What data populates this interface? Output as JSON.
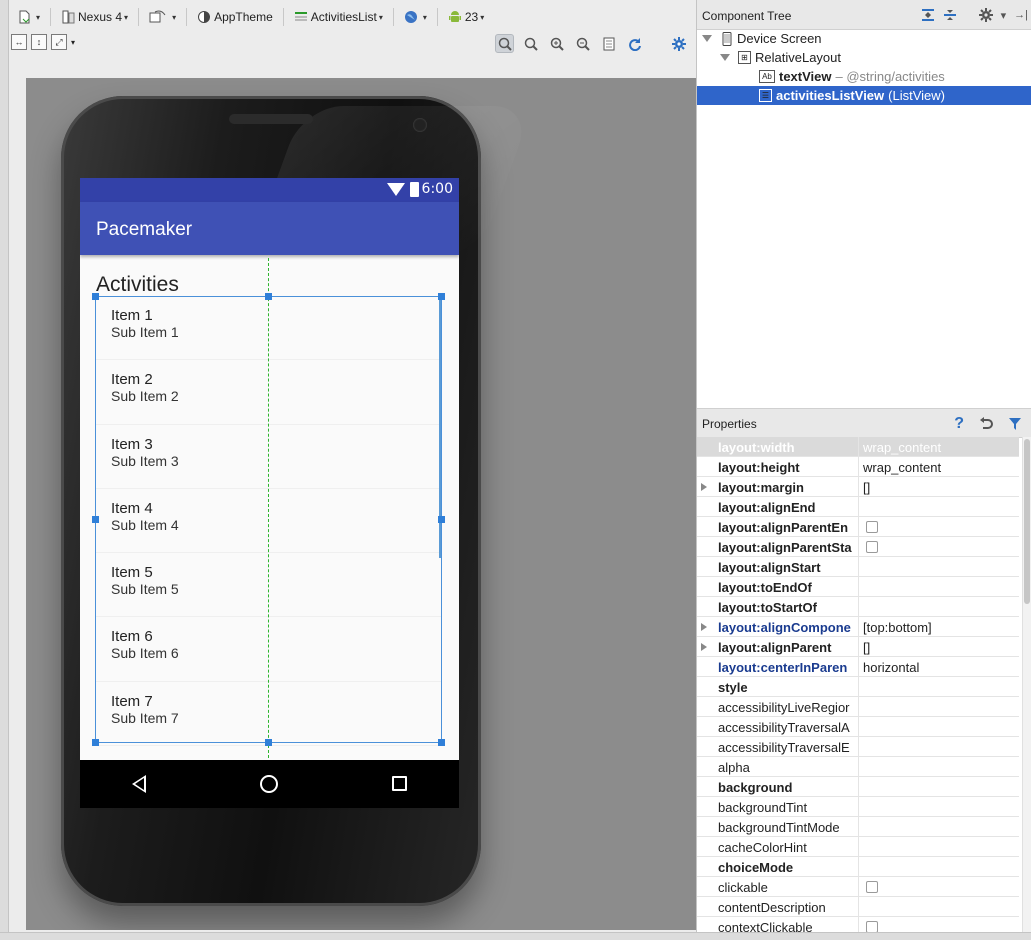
{
  "toolbar": {
    "device_label": "Nexus 4",
    "theme_label": "AppTheme",
    "activity_label": "ActivitiesList",
    "api_label": "23"
  },
  "phone": {
    "status_time": "6:00",
    "app_title": "Pacemaker",
    "heading": "Activities",
    "list_items": [
      {
        "title": "Item 1",
        "subtitle": "Sub Item 1"
      },
      {
        "title": "Item 2",
        "subtitle": "Sub Item 2"
      },
      {
        "title": "Item 3",
        "subtitle": "Sub Item 3"
      },
      {
        "title": "Item 4",
        "subtitle": "Sub Item 4"
      },
      {
        "title": "Item 5",
        "subtitle": "Sub Item 5"
      },
      {
        "title": "Item 6",
        "subtitle": "Sub Item 6"
      },
      {
        "title": "Item 7",
        "subtitle": "Sub Item 7"
      }
    ]
  },
  "component_tree": {
    "title": "Component Tree",
    "nodes": [
      {
        "label": "Device Screen",
        "extra": ""
      },
      {
        "label": "RelativeLayout",
        "extra": ""
      },
      {
        "label": "textView",
        "extra": "– @string/activities"
      },
      {
        "label": "activitiesListView",
        "extra": "(ListView)"
      }
    ]
  },
  "properties": {
    "title": "Properties",
    "rows": [
      {
        "name": "layout:width",
        "value": "wrap_content"
      },
      {
        "name": "layout:height",
        "value": "wrap_content"
      },
      {
        "name": "layout:margin",
        "value": "[]"
      },
      {
        "name": "layout:alignEnd",
        "value": ""
      },
      {
        "name": "layout:alignParentEn",
        "value": ""
      },
      {
        "name": "layout:alignParentSta",
        "value": ""
      },
      {
        "name": "layout:alignStart",
        "value": ""
      },
      {
        "name": "layout:toEndOf",
        "value": ""
      },
      {
        "name": "layout:toStartOf",
        "value": ""
      },
      {
        "name": "layout:alignCompone",
        "value": "[top:bottom]"
      },
      {
        "name": "layout:alignParent",
        "value": "[]"
      },
      {
        "name": "layout:centerInParen",
        "value": "horizontal"
      },
      {
        "name": "style",
        "value": ""
      },
      {
        "name": "accessibilityLiveRegior",
        "value": ""
      },
      {
        "name": "accessibilityTraversalA",
        "value": ""
      },
      {
        "name": "accessibilityTraversalE",
        "value": ""
      },
      {
        "name": "alpha",
        "value": ""
      },
      {
        "name": "background",
        "value": ""
      },
      {
        "name": "backgroundTint",
        "value": ""
      },
      {
        "name": "backgroundTintMode",
        "value": ""
      },
      {
        "name": "cacheColorHint",
        "value": ""
      },
      {
        "name": "choiceMode",
        "value": ""
      },
      {
        "name": "clickable",
        "value": ""
      },
      {
        "name": "contentDescription",
        "value": ""
      },
      {
        "name": "contextClickable",
        "value": ""
      }
    ]
  },
  "colors": {
    "primary": "#3f51b5",
    "primary_dark": "#3341a8",
    "selection": "#2f65ca",
    "guide": "#2fb52f"
  }
}
